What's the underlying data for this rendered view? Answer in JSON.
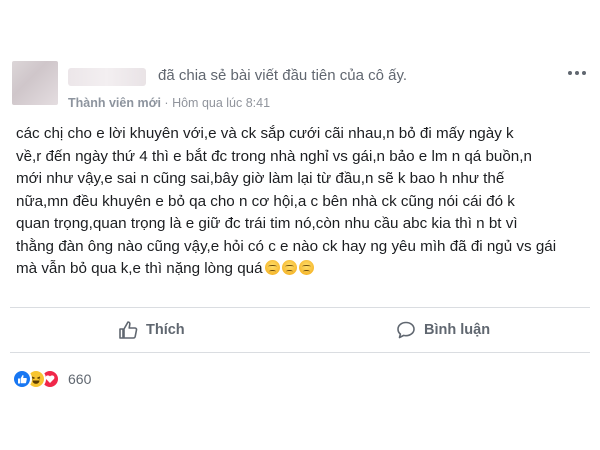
{
  "post": {
    "author_role": "Thành viên mới",
    "share_text": "đã chia sẻ bài viết đầu tiên của cô ấy.",
    "separator": "·",
    "timestamp": "Hôm qua lúc 8:41",
    "body_lines": [
      "các chị cho e lời khuyên với,e và ck sắp cưới cãi nhau,n bỏ đi mấy ngày k",
      "về,r đến ngày thứ 4 thì e bắt đc trong nhà nghỉ vs gái,n bảo e lm n qá buồn,n",
      "mới như vậy,e sai n cũng sai,bây giờ làm lại từ đầu,n sẽ k bao h như thế",
      "nữa,mn đều khuyên e bỏ qa cho n cơ hội,a c bên nhà ck cũng nói cái đó k",
      "quan trọng,quan trọng là e giữ đc trái tim nó,còn nhu cầu abc kia thì n bt vì",
      "thằng đàn ông nào cũng vậy,e hỏi có c e nào ck hay ng yêu mìh đã đi ngủ vs gái",
      "mà vẫn bỏ qua k,e thì nặng lòng quá"
    ],
    "trailing_emoji": [
      "worried-face",
      "worried-face",
      "worried-face"
    ]
  },
  "actions": {
    "like_label": "Thích",
    "comment_label": "Bình luận"
  },
  "reactions": {
    "icons": [
      "like-icon",
      "haha-icon",
      "love-icon"
    ],
    "count": "660"
  },
  "colors": {
    "text": "#1c1e21",
    "meta": "#90949c",
    "like_blue": "#1877f2",
    "love_red": "#f0284a",
    "haha_yellow": "#f7c531"
  }
}
